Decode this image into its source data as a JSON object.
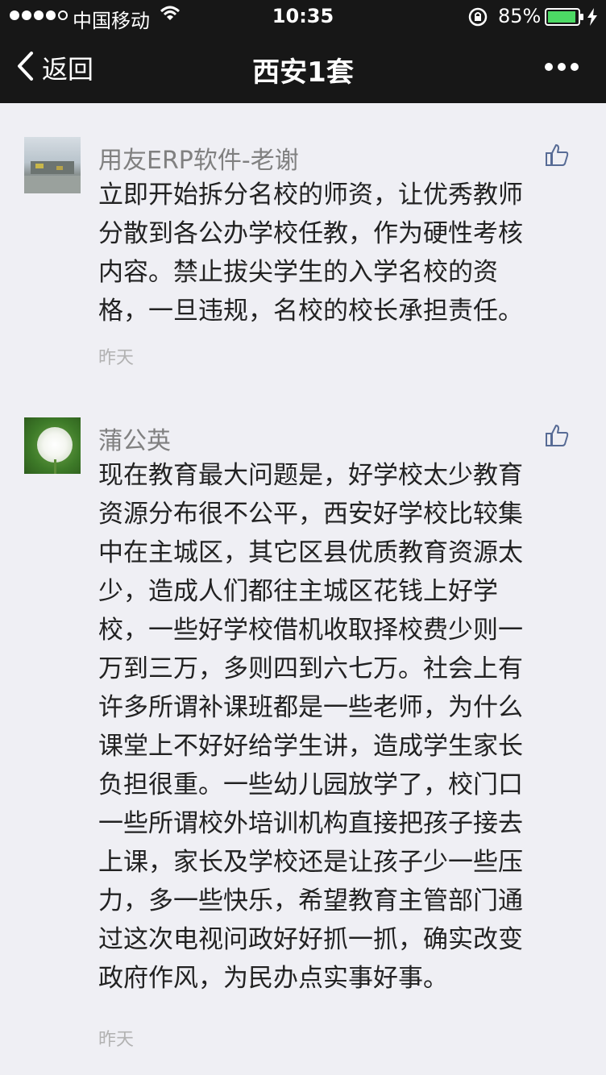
{
  "status_bar": {
    "carrier": "中国移动",
    "time": "10:35",
    "battery_percent": "85%",
    "signal_bars": 4,
    "battery_level": 0.85
  },
  "nav": {
    "back_label": "返回",
    "title": "西安1套"
  },
  "comments": [
    {
      "author": "用友ERP软件-老谢",
      "text": "立即开始拆分名校的师资，让优秀教师\n分散到各公办学校任教，作为硬性考核\n内容。禁止拔尖学生的入学名校的资\n格，一旦违规，名校的校长承担责任。",
      "time": "昨天",
      "avatar_icon": "campus-photo"
    },
    {
      "author": "蒲公英",
      "text": "现在教育最大问题是，好学校太少教育\n资源分布很不公平，西安好学校比较集\n中在主城区，其它区县优质教育资源太\n少，造成人们都往主城区花钱上好学\n校，一些好学校借机收取择校费少则一\n万到三万，多则四到六七万。社会上有\n许多所谓补课班都是一些老师，为什么\n课堂上不好好给学生讲，造成学生家长\n负担很重。一些幼儿园放学了，校门口\n一些所谓校外培训机构直接把孩子接去\n上课，家长及学校还是让孩子少一些压\n力，多一些快乐，希望教育主管部门通\n过这次电视问政好好抓一抓，确实改变\n政府作风，为民办点实事好事。",
      "time": "昨天",
      "avatar_icon": "dandelion-photo"
    }
  ],
  "colors": {
    "bar_background": "#171717",
    "page_background": "#efeff4",
    "author_name": "#808080",
    "body_text": "#222222",
    "time_text": "#b2b2b2"
  }
}
